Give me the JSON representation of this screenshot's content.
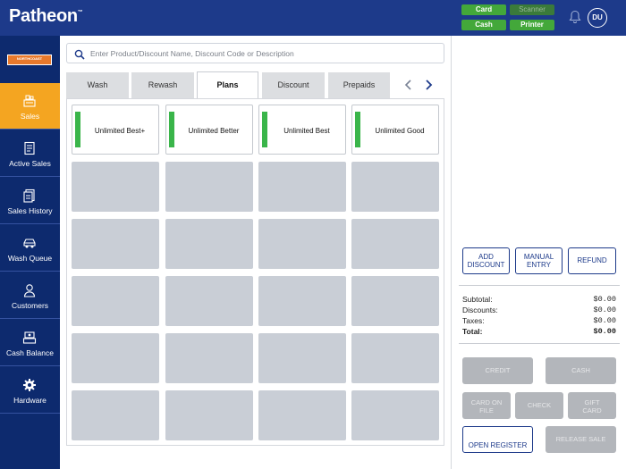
{
  "header": {
    "logo": "Patheon",
    "trademark": "™",
    "status": {
      "card": "Card",
      "scanner": "Scanner",
      "cash": "Cash",
      "printer": "Printer"
    },
    "user_initials": "DU",
    "colors": {
      "brand": "#1d3a8a",
      "status_on": "#43a83a",
      "accent": "#f4a521",
      "plan_bar": "#3ab54a"
    }
  },
  "sidebar": {
    "brand_badge": "NORTHCOAST",
    "items": [
      {
        "label": "Sales",
        "icon": "sales-icon",
        "active": true
      },
      {
        "label": "Active Sales",
        "icon": "receipt-icon"
      },
      {
        "label": "Sales History",
        "icon": "history-icon"
      },
      {
        "label": "Wash Queue",
        "icon": "car-icon"
      },
      {
        "label": "Customers",
        "icon": "user-icon"
      },
      {
        "label": "Cash Balance",
        "icon": "register-icon"
      },
      {
        "label": "Hardware",
        "icon": "gear-icon"
      }
    ]
  },
  "main": {
    "search_placeholder": "Enter Product/Discount Name, Discount Code or Description",
    "tabs": [
      {
        "label": "Wash"
      },
      {
        "label": "Rewash"
      },
      {
        "label": "Plans",
        "active": true
      },
      {
        "label": "Discount"
      },
      {
        "label": "Prepaids"
      }
    ],
    "plans": [
      {
        "name": "Unlimited Best+"
      },
      {
        "name": "Unlimited Better"
      },
      {
        "name": "Unlimited Best"
      },
      {
        "name": "Unlimited Good"
      }
    ]
  },
  "right": {
    "actions": {
      "add_discount_l1": "ADD",
      "add_discount_l2": "DISCOUNT",
      "manual_entry_l1": "MANUAL",
      "manual_entry_l2": "ENTRY",
      "refund": "REFUND"
    },
    "totals": {
      "subtotal_label": "Subtotal:",
      "subtotal": "$0.00",
      "discounts_label": "Discounts:",
      "discounts": "$0.00",
      "taxes_label": "Taxes:",
      "taxes": "$0.00",
      "total_label": "Total:",
      "total": "$0.00"
    },
    "payments": {
      "credit": "CREDIT",
      "cash": "CASH",
      "card_on_file_l1": "CARD ON",
      "card_on_file_l2": "FILE",
      "check": "CHECK",
      "gift_card_l1": "GIFT",
      "gift_card_l2": "CARD",
      "open_register": "OPEN REGISTER",
      "release_sale": "RELEASE SALE"
    }
  }
}
